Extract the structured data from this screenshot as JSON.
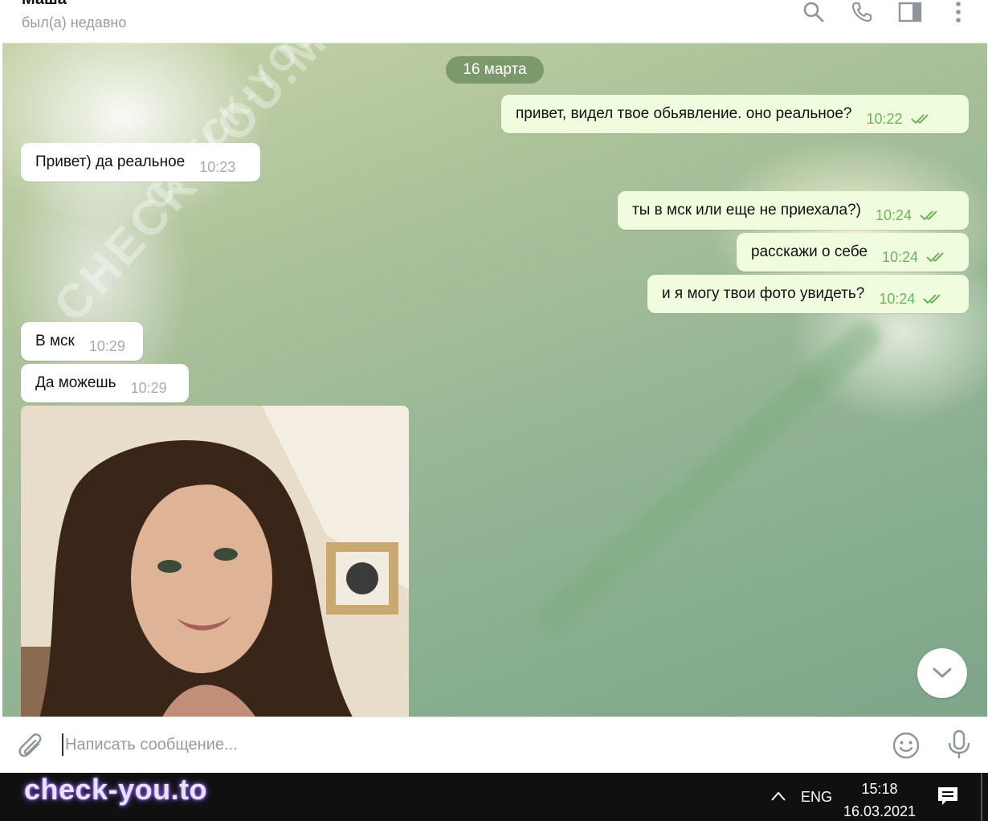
{
  "header": {
    "name": "Маша",
    "status": "был(а) недавно"
  },
  "chat": {
    "date_divider": "16 марта",
    "messages": [
      {
        "dir": "out",
        "text": "привет, видел твое обьявление. оно реальное?",
        "time": "10:22"
      },
      {
        "dir": "in",
        "text": "Привет) да реальное",
        "time": "10:23"
      },
      {
        "dir": "out",
        "text": "ты в мск или еще не приехала?)",
        "time": "10:24"
      },
      {
        "dir": "out",
        "text": "расскажи о себе",
        "time": "10:24"
      },
      {
        "dir": "out",
        "text": "и я могу твои фото увидеть?",
        "time": "10:24"
      },
      {
        "dir": "in",
        "text": "В мск",
        "time": "10:29"
      },
      {
        "dir": "in",
        "text": "Да можешь",
        "time": "10:29"
      }
    ]
  },
  "composer": {
    "placeholder": "Написать сообщение..."
  },
  "watermark": {
    "text": "CHECK-YOU.ME"
  },
  "taskbar": {
    "brand": "check-you.to",
    "lang": "ENG",
    "time": "15:18",
    "date": "16.03.2021"
  },
  "colors": {
    "outgoing_bubble": "#effdde",
    "incoming_bubble": "#ffffff",
    "outgoing_time": "#6fb35f",
    "date_pill": "#719164"
  },
  "icons": [
    "search-icon",
    "phone-icon",
    "sidebar-toggle-icon",
    "more-icon",
    "chevron-down-icon",
    "attach-icon",
    "emoji-icon",
    "microphone-icon",
    "tray-chevron-up-icon",
    "notification-icon",
    "double-check-icon"
  ]
}
